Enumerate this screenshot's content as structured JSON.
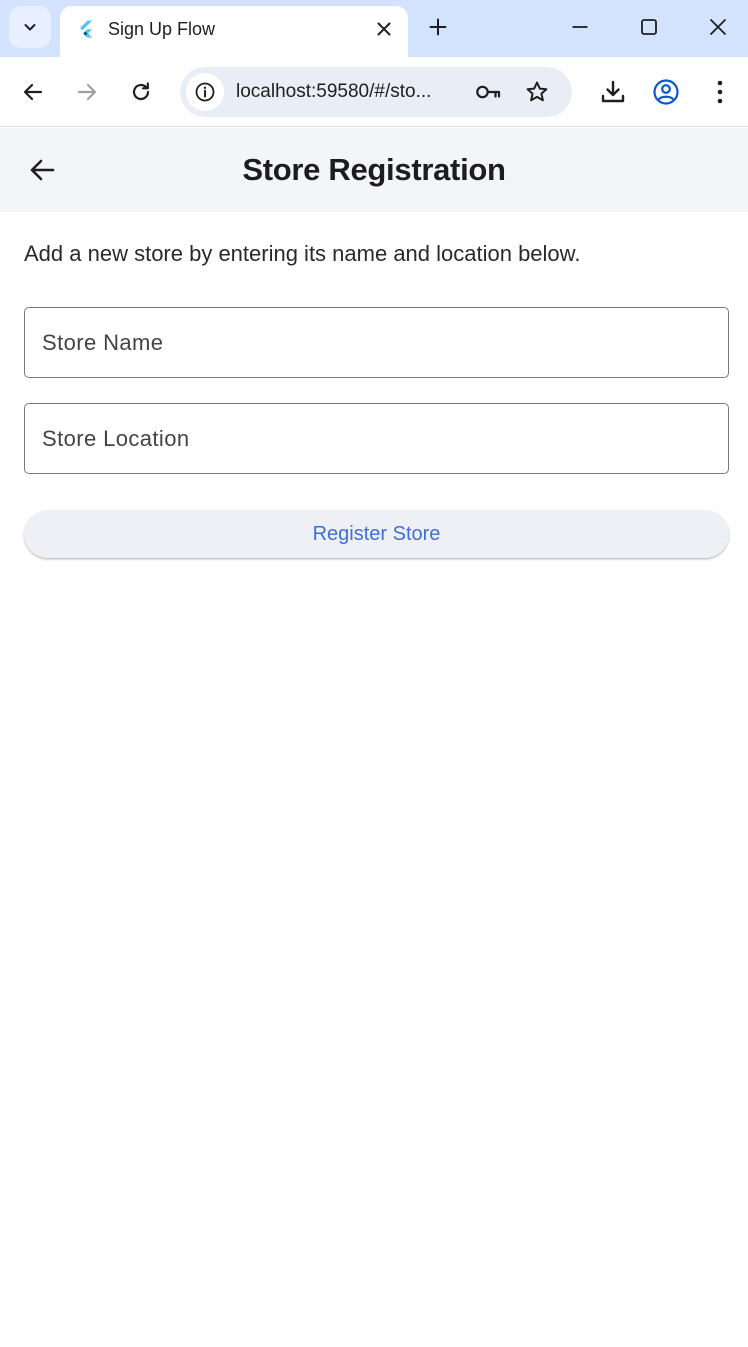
{
  "browser": {
    "tab": {
      "title": "Sign Up Flow"
    },
    "omnibox": {
      "url": "localhost:59580/#/sto..."
    }
  },
  "app": {
    "title": "Store Registration",
    "intro": "Add a new store by entering its name and location below.",
    "fields": {
      "store_name": {
        "placeholder": "Store Name",
        "value": ""
      },
      "store_location": {
        "placeholder": "Store Location",
        "value": ""
      }
    },
    "register_button_label": "Register Store"
  },
  "colors": {
    "tabstrip_bg": "#d3e3fd",
    "appbar_bg": "#f4f5f7",
    "button_text": "#3d6fd6",
    "button_bg": "#eef0f5",
    "flutter_blue_light": "#54c5f8",
    "flutter_blue_dark": "#01579b",
    "profile_blue": "#0b57d0"
  }
}
